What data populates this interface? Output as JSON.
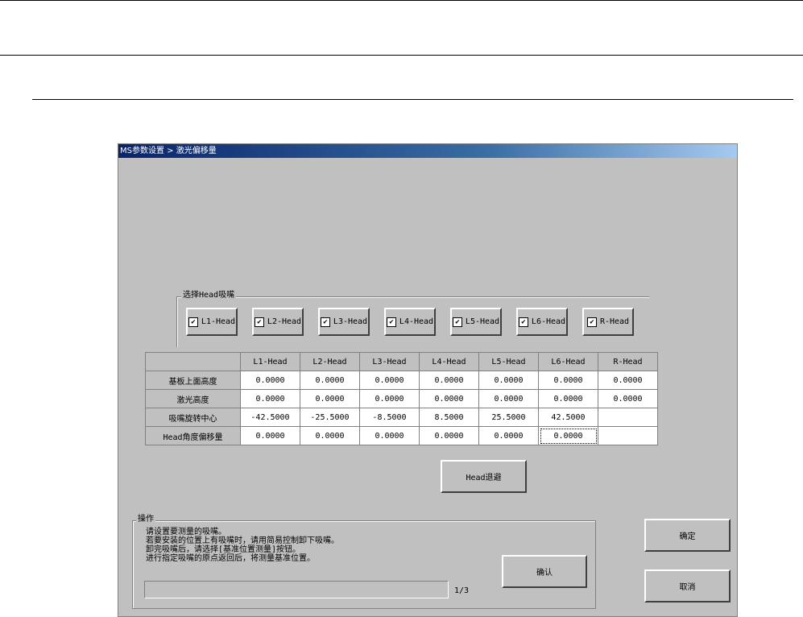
{
  "window": {
    "title": "MS参数设置 > 激光偏移量"
  },
  "head_select": {
    "legend": "选择Head吸嘴",
    "heads": [
      {
        "label": "L1-Head",
        "checked": true
      },
      {
        "label": "L2-Head",
        "checked": true
      },
      {
        "label": "L3-Head",
        "checked": true
      },
      {
        "label": "L4-Head",
        "checked": true
      },
      {
        "label": "L5-Head",
        "checked": true
      },
      {
        "label": "L6-Head",
        "checked": true
      },
      {
        "label": "R-Head",
        "checked": true
      }
    ]
  },
  "table": {
    "columns": [
      "L1-Head",
      "L2-Head",
      "L3-Head",
      "L4-Head",
      "L5-Head",
      "L6-Head",
      "R-Head"
    ],
    "rows": [
      {
        "label": "基板上面高度",
        "values": [
          "0.0000",
          "0.0000",
          "0.0000",
          "0.0000",
          "0.0000",
          "0.0000",
          "0.0000"
        ]
      },
      {
        "label": "激光高度",
        "values": [
          "0.0000",
          "0.0000",
          "0.0000",
          "0.0000",
          "0.0000",
          "0.0000",
          "0.0000"
        ]
      },
      {
        "label": "吸嘴旋转中心",
        "values": [
          "-42.5000",
          "-25.5000",
          "-8.5000",
          "8.5000",
          "25.5000",
          "42.5000",
          ""
        ]
      },
      {
        "label": "Head角度偏移量",
        "values": [
          "0.0000",
          "0.0000",
          "0.0000",
          "0.0000",
          "0.0000",
          "0.0000",
          ""
        ]
      }
    ]
  },
  "head_evade_label": "Head退避",
  "operation": {
    "legend": "操作",
    "lines": [
      "请设置要测量的吸嘴。",
      "若要安装的位置上有吸嘴时，请用简易控制卸下吸嘴。",
      "卸完吸嘴后，请选择[基准位置测量]按钮。",
      "进行指定吸嘴的原点返回后，将测量基准位置。"
    ],
    "confirm_label": "确认",
    "progress": {
      "current": 1,
      "total": 3,
      "text": "1/3"
    }
  },
  "ok_label": "确定",
  "cancel_label": "取消",
  "check_mark": "✔"
}
